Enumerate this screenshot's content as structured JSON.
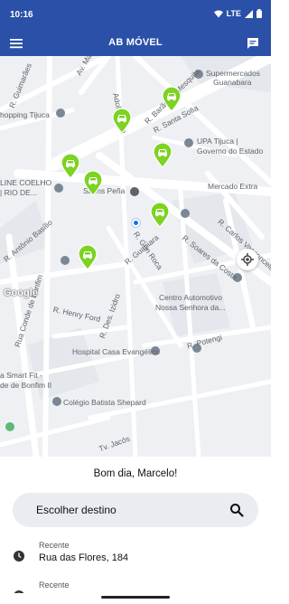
{
  "status_bar": {
    "time": "10:16",
    "network": "LTE"
  },
  "app_bar": {
    "title": "AB MÓVEL"
  },
  "icons": {
    "menu": "menu-icon",
    "chat": "chat-icon",
    "search": "search-icon",
    "recent": "clock-icon",
    "locate": "my-location-icon",
    "car": "car-pin-icon"
  },
  "colors": {
    "brand": "#2a50a8",
    "car_pin": "#7cd321",
    "user_location": "#1a73e8"
  },
  "map": {
    "labels": {
      "street_guimaraes": "R. Guimarães",
      "av_mal": "Av. Ma...",
      "adolfo_mota": "Adolfo Mota",
      "barao_mesquita": "R. Barão de Mesquita",
      "santa_sofia": "R. Santa Sofia",
      "supermercados": "Supermercados",
      "guanabara": "Guanabara",
      "shopping_tijuca": "hopping Tijuca",
      "upa_tijuca": "UPA Tijuca |",
      "governo_estado": "Governo do Estado",
      "line_coelho": "LINE COELHO",
      "rio_de": "| RIO DE...",
      "saens_pena": "Saens Peña",
      "mercado_extra": "Mercado Extra",
      "gen_roca": "R. Gen Roca",
      "soares_costa": "R. Soares da Costa",
      "carlos_vasconcelos": "R. Carlos Vasconcelos",
      "antonio_basilio": "R. Antônio Basílio",
      "guapiara": "R. Guapiara",
      "centro_automotivo": "Centro Automotivo",
      "nossa_senhora": "Nossa Senhora da...",
      "conde_bonfim": "Rua Conde de Bonfim",
      "henry_ford": "R. Henry Ford",
      "des_izidro": "R. Des. Izidro",
      "potengi": "R. Potengi",
      "hospital": "Hospital Casa Evangélico",
      "smart_fit": "a Smart Fit -",
      "bonfim_ii": "de de Bonfim II",
      "colegio": "Colégio Batista Shepard",
      "jacos": "Tv. Jacós"
    }
  },
  "sheet": {
    "greeting": "Bom dia, Marcelo!",
    "search": {
      "label": "Escolher destino"
    },
    "recents": [
      {
        "kicker": "Recente",
        "address": "Rua das Flores, 184"
      },
      {
        "kicker": "Recente",
        "address": ""
      }
    ]
  }
}
